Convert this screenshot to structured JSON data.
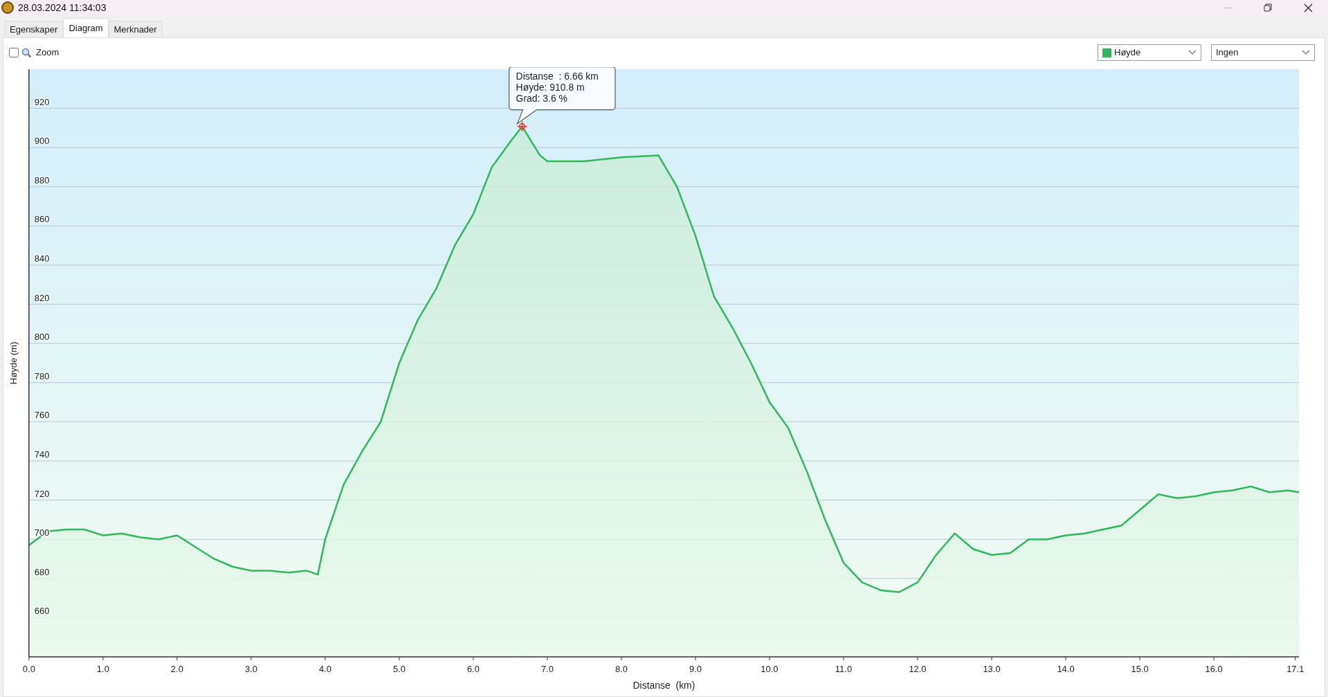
{
  "window": {
    "title": "28.03.2024 11:34:03"
  },
  "tabs": [
    {
      "label": "Egenskaper",
      "selected": false
    },
    {
      "label": "Diagram",
      "selected": true
    },
    {
      "label": "Merknader",
      "selected": false
    }
  ],
  "toolbar": {
    "zoom": {
      "label": "Zoom",
      "checked": false
    },
    "second_select": {
      "value": "Ingen"
    }
  },
  "chart": {
    "tooltip": {
      "lines": [
        "Distanse  : 6.66 km",
        "Høyde: 910.8 m",
        "Grad: 3.6 %"
      ]
    },
    "chart_data": {
      "type": "area",
      "grid": true,
      "xlabel": "Distanse  (km)",
      "ylabel": "Høyde (m)",
      "x": [
        0,
        0.25,
        0.5,
        0.75,
        1.0,
        1.25,
        1.5,
        1.75,
        2.0,
        2.25,
        2.5,
        2.75,
        3.0,
        3.25,
        3.5,
        3.75,
        3.9,
        4.0,
        4.25,
        4.5,
        4.75,
        5.0,
        5.25,
        5.5,
        5.75,
        6.0,
        6.25,
        6.5,
        6.66,
        6.9,
        7.0,
        7.5,
        8.0,
        8.5,
        8.75,
        9.0,
        9.25,
        9.5,
        9.75,
        10.0,
        10.25,
        10.5,
        10.75,
        11.0,
        11.25,
        11.5,
        11.75,
        12.0,
        12.25,
        12.5,
        12.75,
        13.0,
        13.25,
        13.5,
        13.75,
        14.0,
        14.25,
        14.5,
        14.75,
        15.0,
        15.25,
        15.5,
        15.75,
        16.0,
        16.25,
        16.5,
        16.75,
        17.0,
        17.15
      ],
      "series": [
        {
          "name": "Høyde",
          "color": "#2eb85c",
          "values": [
            697,
            704,
            705,
            705,
            702,
            703,
            701,
            700,
            702,
            696,
            690,
            686,
            684,
            684,
            683,
            684,
            682,
            700,
            728,
            745,
            760,
            790,
            812,
            828,
            850,
            866,
            890,
            903,
            910.8,
            896,
            893,
            893,
            895,
            896,
            880,
            855,
            824,
            808,
            790,
            770,
            757,
            735,
            710,
            688,
            678,
            674,
            673,
            678,
            692,
            703,
            695,
            692,
            693,
            700,
            700,
            702,
            703,
            705,
            707,
            715,
            723,
            721,
            722,
            724,
            725,
            727,
            724,
            725,
            724
          ]
        }
      ],
      "xlim": [
        0,
        17.15
      ],
      "ylim": [
        640,
        940
      ],
      "xticks": [
        {
          "value": 0,
          "label": "0.0"
        },
        {
          "value": 1,
          "label": "1.0"
        },
        {
          "value": 2,
          "label": "2.0"
        },
        {
          "value": 3,
          "label": "3.0"
        },
        {
          "value": 4,
          "label": "4.0"
        },
        {
          "value": 5,
          "label": "5.0"
        },
        {
          "value": 6,
          "label": "6.0"
        },
        {
          "value": 7,
          "label": "7.0"
        },
        {
          "value": 8,
          "label": "8.0"
        },
        {
          "value": 9,
          "label": "9.0"
        },
        {
          "value": 10,
          "label": "10.0"
        },
        {
          "value": 11,
          "label": "11.0"
        },
        {
          "value": 12,
          "label": "12.0"
        },
        {
          "value": 13,
          "label": "13.0"
        },
        {
          "value": 14,
          "label": "14.0"
        },
        {
          "value": 15,
          "label": "15.0"
        },
        {
          "value": 16,
          "label": "16.0"
        },
        {
          "value": 17.1,
          "label": "17.1"
        }
      ],
      "yticks": [
        660,
        680,
        700,
        720,
        740,
        760,
        780,
        800,
        820,
        840,
        860,
        880,
        900,
        920
      ]
    }
  }
}
